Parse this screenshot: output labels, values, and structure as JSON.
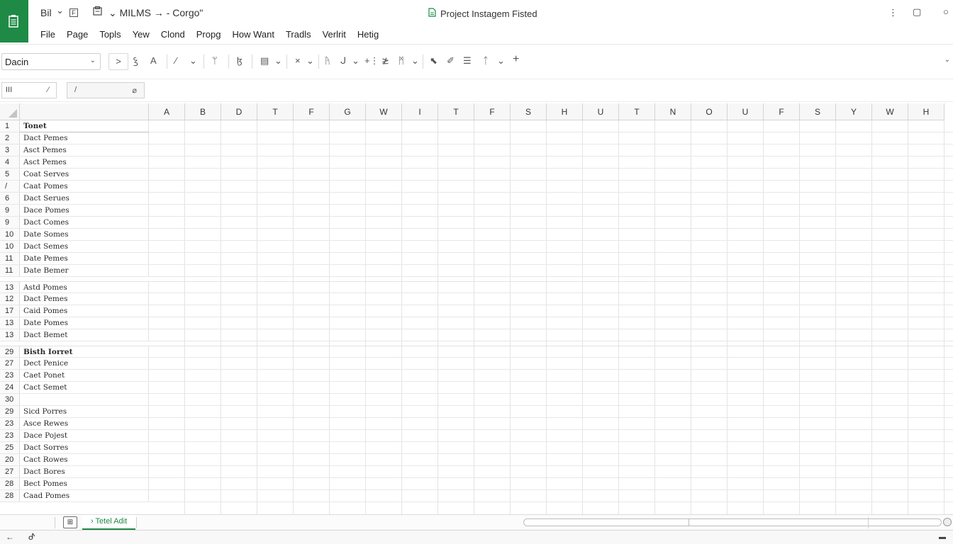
{
  "titlebar": {
    "app_name": "Bil",
    "app_caret": "⌄",
    "file_icon": "F",
    "path": "⌄ MILMS → - Corgo\"",
    "doc_title": "Project Instagem Fisted",
    "right_icon_1": "⋮",
    "right_icon_2": "▢",
    "right_icon_3": "○"
  },
  "menu": [
    "File",
    "Page",
    "Topls",
    "Yew",
    "Clond",
    "Propg",
    "How Want",
    "Tradls",
    "Verlrit",
    "Hetig"
  ],
  "ribbon": {
    "font_name": "Dacin",
    "caret": "⌄",
    "buttons": [
      ">",
      "ꝣ",
      "A",
      "⁄",
      "⌄",
      "ᛘ",
      "ɮ",
      "▤",
      "⌄",
      "×",
      "⌄",
      "ᚤ",
      "ᒍ",
      "⌄",
      "+⋮",
      "≵",
      "ᛗ",
      "⌄",
      "⬉",
      "✐",
      "☰",
      "ᛏ",
      "⌄",
      "+"
    ],
    "end_caret": "⌄"
  },
  "formula_bar": {
    "name_box": "III",
    "name_box_icon": "⁄",
    "input_value": "/",
    "fx_icon": "⌀"
  },
  "columns": [
    "A",
    "B",
    "D",
    "T",
    "F",
    "G",
    "W",
    "I",
    "T",
    "F",
    "S",
    "H",
    "U",
    "T",
    "N",
    "O",
    "U",
    "F",
    "S",
    "Y",
    "W",
    "H"
  ],
  "rows": [
    {
      "num": "1",
      "label": "Tonet",
      "bold": true
    },
    {
      "num": "2",
      "label": "Dact Pemes"
    },
    {
      "num": "3",
      "label": "Asct Pemes"
    },
    {
      "num": "4",
      "label": "Asct Pemes"
    },
    {
      "num": "5",
      "label": "Coat Serves"
    },
    {
      "num": "/",
      "label": "Caat Pomes"
    },
    {
      "num": "6",
      "label": "Dact Serues"
    },
    {
      "num": "9",
      "label": "Dace Pomes"
    },
    {
      "num": "9",
      "label": "Dact Comes"
    },
    {
      "num": "10",
      "label": "Date Somes"
    },
    {
      "num": "10",
      "label": "Dact Semes"
    },
    {
      "num": "11",
      "label": "Date Pemes"
    },
    {
      "num": "11",
      "label": "Date Bemer"
    },
    {
      "num": "13",
      "label": "Astd Pomes",
      "gap": true
    },
    {
      "num": "12",
      "label": "Dact Pemes"
    },
    {
      "num": "17",
      "label": "Caid Pomes"
    },
    {
      "num": "13",
      "label": "Date Pomes"
    },
    {
      "num": "13",
      "label": "Dact Bemet"
    },
    {
      "num": "29",
      "label": "Bisth Iorret",
      "bold": true,
      "gap": true
    },
    {
      "num": "27",
      "label": "Dect Penice"
    },
    {
      "num": "23",
      "label": "Caet Ponet"
    },
    {
      "num": "24",
      "label": "Cact Semet"
    },
    {
      "num": "30",
      "label": ""
    },
    {
      "num": "29",
      "label": "Sicd Porres"
    },
    {
      "num": "23",
      "label": "Asce Rewes"
    },
    {
      "num": "23",
      "label": "Dace Pojest"
    },
    {
      "num": "25",
      "label": "Dact Sorres"
    },
    {
      "num": "20",
      "label": "Cact Rowes"
    },
    {
      "num": "27",
      "label": "Dact Bores"
    },
    {
      "num": "28",
      "label": "Bect Pomes"
    },
    {
      "num": "28",
      "label": "Caad Pomes"
    }
  ],
  "sheet_tabs": {
    "add_icon": "⊞",
    "active_tab": "› Tetel Adit"
  },
  "statusbar": {
    "left_icon": "←",
    "left_icon_2": "ᕷ",
    "right_icon": "▬"
  },
  "colors": {
    "brand": "#1e8a45"
  }
}
